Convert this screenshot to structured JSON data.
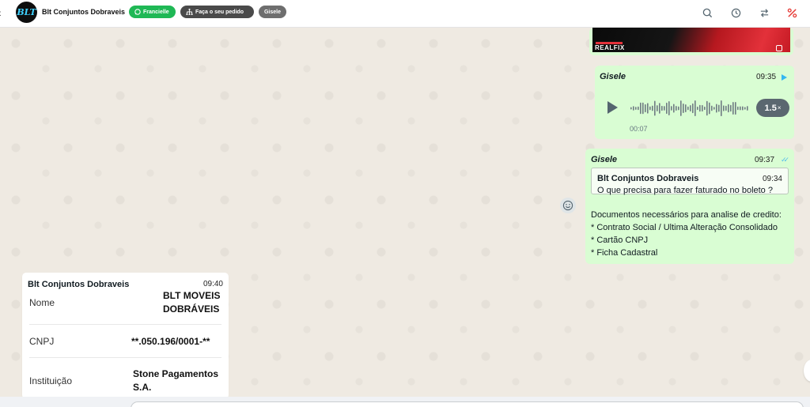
{
  "header": {
    "contact_name": "Blt Conjuntos Dobraveis",
    "avatar_text": "BLT",
    "tags": [
      {
        "label": "Francielle",
        "color": "#1fb855",
        "icon": "whatsapp-icon"
      },
      {
        "label": "Faça o seu pedido",
        "color": "#4a4a4a",
        "icon": "sitemap-icon"
      },
      {
        "label": "Gisele",
        "color": "#6e6e6e"
      }
    ],
    "icons": [
      "search-icon",
      "history-icon",
      "transfer-icon",
      "percent-icon"
    ]
  },
  "messages": {
    "image": {
      "brand_text": "REALFIX"
    },
    "audio": {
      "sender": "Gisele",
      "time": "09:35",
      "duration": "00:07",
      "speed": "1.5",
      "speed_suffix": "×"
    },
    "reply": {
      "sender": "Gisele",
      "time": "09:37",
      "quoted": {
        "name": "Blt Conjuntos Dobraveis",
        "time": "09:34",
        "text": "O que precisa para fazer faturado no boleto ?"
      },
      "lines": [
        "Documentos necessários para analise de credito:",
        "* Contrato Social / Ultima Alteração Consolidado",
        "* Cartão CNPJ",
        "* Ficha Cadastral"
      ]
    },
    "card": {
      "sender": "Blt Conjuntos Dobraveis",
      "time": "09:40",
      "rows": [
        {
          "label": "Nome",
          "value_lines": [
            "BLT MOVEIS",
            "DOBRÁVEIS"
          ]
        },
        {
          "label": "CNPJ",
          "value_lines": [
            "**.050.196/0001-**"
          ]
        },
        {
          "label": "Instituição",
          "value_lines": [
            "Stone Pagamentos",
            "S.A."
          ]
        }
      ]
    }
  },
  "colors": {
    "outgoing_bubble": "#d9fdd3",
    "chat_bg": "#efeae2",
    "read_ticks": "#53bdeb",
    "percent_icon": "#e53935"
  }
}
